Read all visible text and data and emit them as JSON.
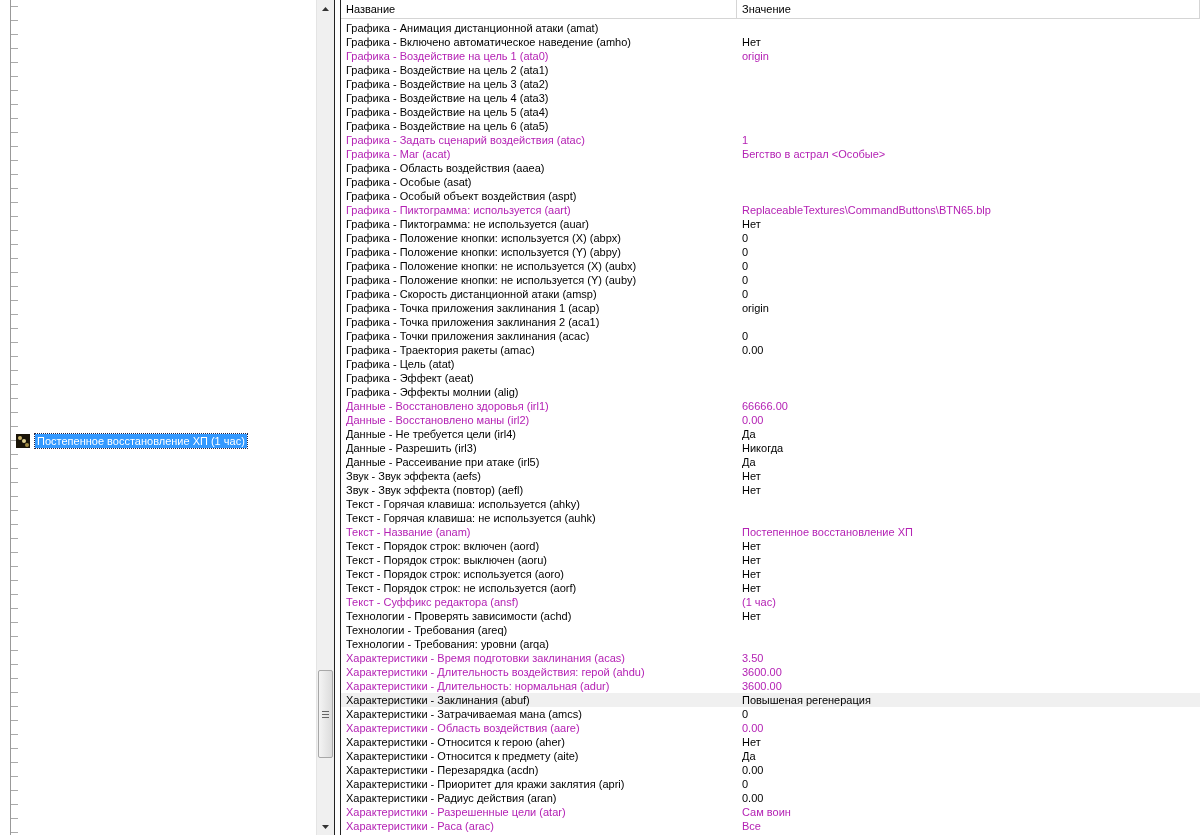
{
  "tree": {
    "items": [
      {
        "label": "Постепенное восстановление ХП (1 час)",
        "selected": true
      }
    ]
  },
  "table": {
    "columns": [
      "Название",
      "Значение"
    ],
    "rows": [
      {
        "name": "Графика - Анимация дистанционной атаки (amat)",
        "modified": false,
        "selected": false
      },
      {
        "name": "Графика - Включено автоматическое наведение (amho)",
        "value": "Нет",
        "modified": false,
        "selected": false
      },
      {
        "name": "Графика - Воздействие на цель 1 (ata0)",
        "value": "origin",
        "modified": true,
        "selected": false
      },
      {
        "name": "Графика - Воздействие на цель 2 (ata1)",
        "modified": false,
        "selected": false
      },
      {
        "name": "Графика - Воздействие на цель 3 (ata2)",
        "modified": false,
        "selected": false
      },
      {
        "name": "Графика - Воздействие на цель 4 (ata3)",
        "modified": false,
        "selected": false
      },
      {
        "name": "Графика - Воздействие на цель 5 (ata4)",
        "modified": false,
        "selected": false
      },
      {
        "name": "Графика - Воздействие на цель 6 (ata5)",
        "modified": false,
        "selected": false
      },
      {
        "name": "Графика - Задать сценарий воздействия (atac)",
        "value": "1",
        "modified": true,
        "selected": false
      },
      {
        "name": "Графика - Маг (acat)",
        "value": "Бегство в астрал <Особые>",
        "modified": true,
        "selected": false
      },
      {
        "name": "Графика - Область воздействия (aaea)",
        "modified": false,
        "selected": false
      },
      {
        "name": "Графика - Особые (asat)",
        "modified": false,
        "selected": false
      },
      {
        "name": "Графика - Особый объект воздействия (aspt)",
        "modified": false,
        "selected": false
      },
      {
        "name": "Графика - Пиктограмма: используется (aart)",
        "value": "ReplaceableTextures\\CommandButtons\\BTN65.blp",
        "modified": true,
        "selected": false
      },
      {
        "name": "Графика - Пиктограмма: не используется (auar)",
        "value": "Нет",
        "modified": false,
        "selected": false
      },
      {
        "name": "Графика - Положение кнопки: используется (X) (abpx)",
        "value": "0",
        "modified": false,
        "selected": false
      },
      {
        "name": "Графика - Положение кнопки: используется (Y) (abpy)",
        "value": "0",
        "modified": false,
        "selected": false
      },
      {
        "name": "Графика - Положение кнопки: не используется (X) (aubx)",
        "value": "0",
        "modified": false,
        "selected": false
      },
      {
        "name": "Графика - Положение кнопки: не используется (Y) (auby)",
        "value": "0",
        "modified": false,
        "selected": false
      },
      {
        "name": "Графика - Скорость дистанционной атаки (amsp)",
        "value": "0",
        "modified": false,
        "selected": false
      },
      {
        "name": "Графика - Точка приложения заклинания 1 (acap)",
        "value": "origin",
        "modified": false,
        "selected": false
      },
      {
        "name": "Графика - Точка приложения заклинания 2 (aca1)",
        "modified": false,
        "selected": false
      },
      {
        "name": "Графика - Точки приложения заклинания (acac)",
        "value": "0",
        "modified": false,
        "selected": false
      },
      {
        "name": "Графика - Траектория ракеты (amac)",
        "value": "0.00",
        "modified": false,
        "selected": false
      },
      {
        "name": "Графика - Цель (atat)",
        "modified": false,
        "selected": false
      },
      {
        "name": "Графика - Эффект (aeat)",
        "modified": false,
        "selected": false
      },
      {
        "name": "Графика - Эффекты молнии (alig)",
        "modified": false,
        "selected": false
      },
      {
        "name": "Данные - Восстановлено здоровья (irl1)",
        "value": "66666.00",
        "modified": true,
        "selected": false
      },
      {
        "name": "Данные - Восстановлено маны (irl2)",
        "value": "0.00",
        "modified": true,
        "selected": false
      },
      {
        "name": "Данные - Не требуется цели (irl4)",
        "value": "Да",
        "modified": false,
        "selected": false
      },
      {
        "name": "Данные - Разрешить (irl3)",
        "value": "Никогда",
        "modified": false,
        "selected": false
      },
      {
        "name": "Данные - Рассеивание при атаке (irl5)",
        "value": "Да",
        "modified": false,
        "selected": false
      },
      {
        "name": "Звук - Звук эффекта (aefs)",
        "value": "Нет",
        "modified": false,
        "selected": false
      },
      {
        "name": "Звук - Звук эффекта (повтор) (aefl)",
        "value": "Нет",
        "modified": false,
        "selected": false
      },
      {
        "name": "Текст - Горячая клавиша: используется (ahky)",
        "modified": false,
        "selected": false
      },
      {
        "name": "Текст - Горячая клавиша: не используется (auhk)",
        "modified": false,
        "selected": false
      },
      {
        "name": "Текст - Название (anam)",
        "value": "Постепенное восстановление ХП",
        "modified": true,
        "selected": false
      },
      {
        "name": "Текст - Порядок строк: включен (aord)",
        "value": "Нет",
        "modified": false,
        "selected": false
      },
      {
        "name": "Текст - Порядок строк: выключен (aoru)",
        "value": "Нет",
        "modified": false,
        "selected": false
      },
      {
        "name": "Текст - Порядок строк: используется (aoro)",
        "value": "Нет",
        "modified": false,
        "selected": false
      },
      {
        "name": "Текст - Порядок строк: не используется (aorf)",
        "value": "Нет",
        "modified": false,
        "selected": false
      },
      {
        "name": "Текст - Суффикс редактора (ansf)",
        "value": "(1 час)",
        "modified": true,
        "selected": false
      },
      {
        "name": "Технологии - Проверять зависимости (achd)",
        "value": "Нет",
        "modified": false,
        "selected": false
      },
      {
        "name": "Технологии - Требования (areq)",
        "modified": false,
        "selected": false
      },
      {
        "name": "Технологии - Требования: уровни (arqa)",
        "modified": false,
        "selected": false
      },
      {
        "name": "Характеристики - Время подготовки заклинания (acas)",
        "value": "3.50",
        "modified": true,
        "selected": false
      },
      {
        "name": "Характеристики - Длительность воздействия: герой (ahdu)",
        "value": "3600.00",
        "modified": true,
        "selected": false
      },
      {
        "name": "Характеристики - Длительность: нормальная (adur)",
        "value": "3600.00",
        "modified": true,
        "selected": false
      },
      {
        "name": "Характеристики - Заклинания (abuf)",
        "value": "Повышеная регенерация",
        "modified": false,
        "selected": true
      },
      {
        "name": "Характеристики - Затрачиваемая мана (amcs)",
        "value": "0",
        "modified": false,
        "selected": false
      },
      {
        "name": "Характеристики - Область воздействия (aare)",
        "value": "0.00",
        "modified": true,
        "selected": false
      },
      {
        "name": "Характеристики - Относится к герою (aher)",
        "value": "Нет",
        "modified": false,
        "selected": false
      },
      {
        "name": "Характеристики - Относится к предмету (aite)",
        "value": "Да",
        "modified": false,
        "selected": false
      },
      {
        "name": "Характеристики - Перезарядка (acdn)",
        "value": "0.00",
        "modified": false,
        "selected": false
      },
      {
        "name": "Характеристики - Приоритет для кражи заклятия (apri)",
        "value": "0",
        "modified": false,
        "selected": false
      },
      {
        "name": "Характеристики - Радиус действия (aran)",
        "value": "0.00",
        "modified": false,
        "selected": false
      },
      {
        "name": "Характеристики - Разрешенные цели (atar)",
        "value": "Сам воин",
        "modified": true,
        "selected": false
      },
      {
        "name": "Характеристики - Раса (arac)",
        "value": "Все",
        "modified": true,
        "selected": false
      }
    ]
  }
}
